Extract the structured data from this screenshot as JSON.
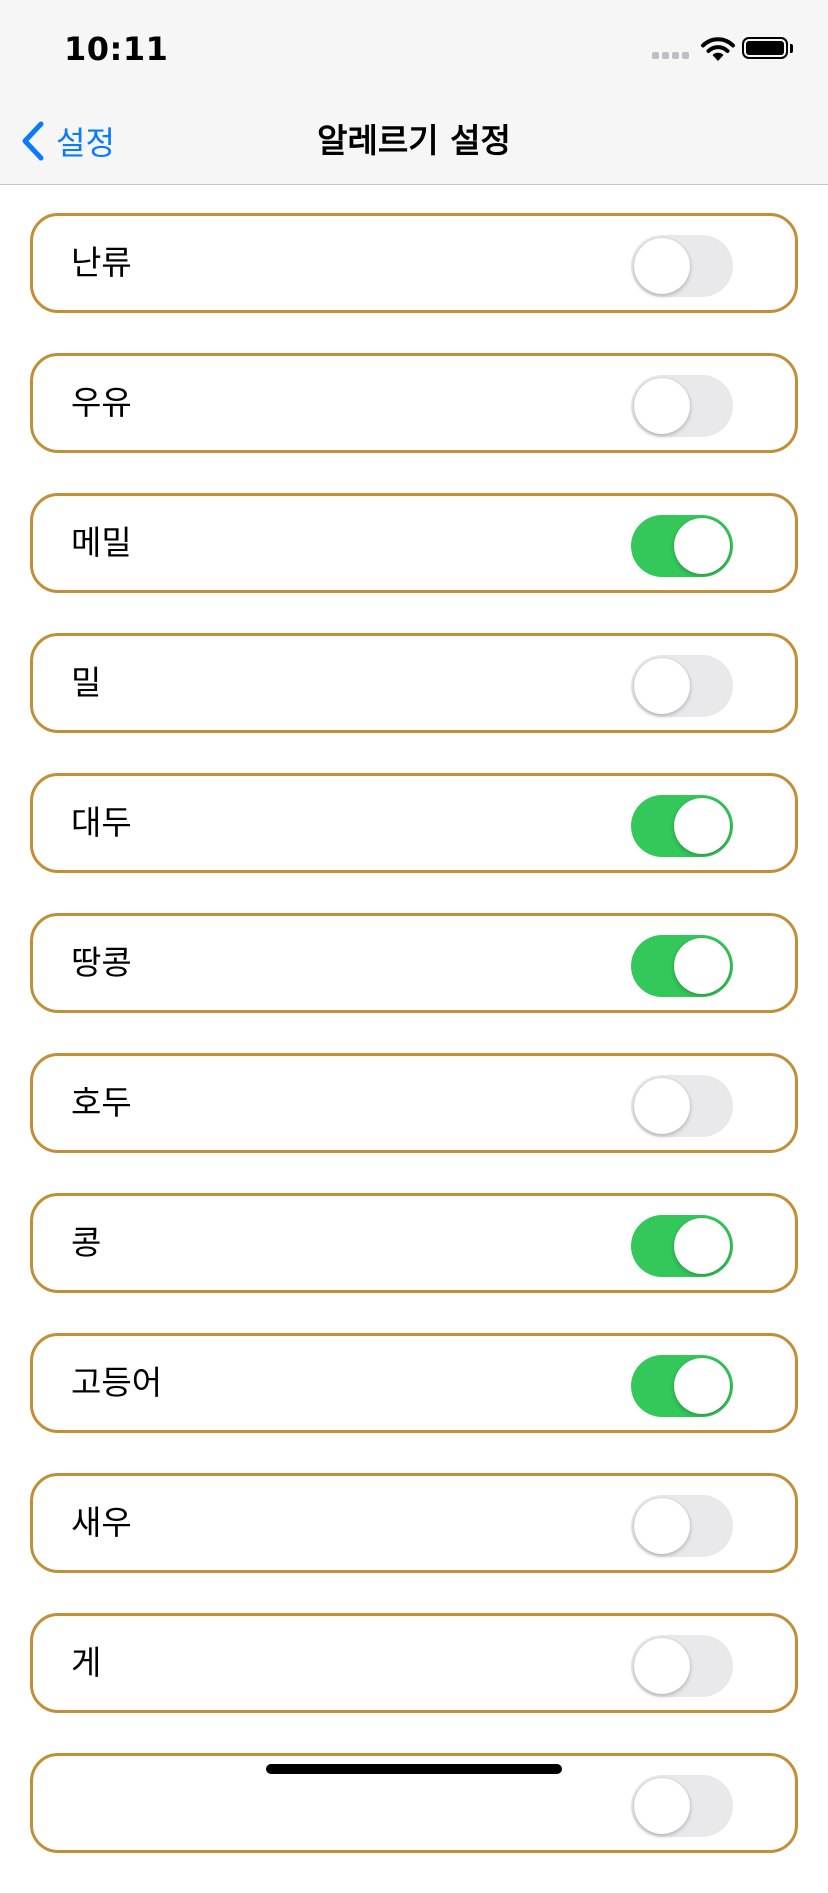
{
  "status_bar": {
    "time": "10:11"
  },
  "nav": {
    "back_label": "설정",
    "title": "알레르기 설정"
  },
  "allergies": [
    {
      "label": "난류",
      "enabled": false
    },
    {
      "label": "우유",
      "enabled": false
    },
    {
      "label": "메밀",
      "enabled": true
    },
    {
      "label": "밀",
      "enabled": false
    },
    {
      "label": "대두",
      "enabled": true
    },
    {
      "label": "땅콩",
      "enabled": true
    },
    {
      "label": "호두",
      "enabled": false
    },
    {
      "label": "콩",
      "enabled": true
    },
    {
      "label": "고등어",
      "enabled": true
    },
    {
      "label": "새우",
      "enabled": false
    },
    {
      "label": "게",
      "enabled": false
    },
    {
      "label": "",
      "enabled": false
    }
  ],
  "colors": {
    "accent": "#0a7aff",
    "toggle_on": "#34c759",
    "toggle_off": "#e9e9eb",
    "row_border": "#c28f38"
  }
}
